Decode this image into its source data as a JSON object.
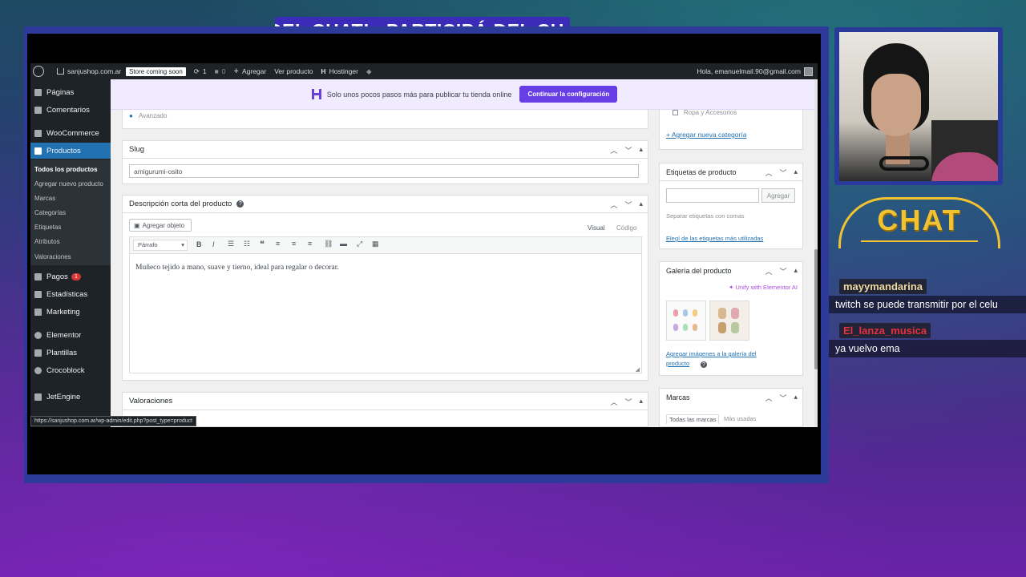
{
  "banner": {
    "text": "DEL CHAT!   PARTICIPÁ DEL CH"
  },
  "adminbar": {
    "site": "sanjushop.com.ar",
    "store_badge": "Store coming soon",
    "updates": "1",
    "comments": "0",
    "add": "Agregar",
    "view_product": "Ver producto",
    "hostinger": "Hostinger",
    "greeting": "Hola, emanuelmail.90@gmail.com"
  },
  "sidebar": {
    "items": [
      {
        "label": "Páginas"
      },
      {
        "label": "Comentarios"
      },
      {
        "label": "WooCommerce"
      },
      {
        "label": "Productos"
      },
      {
        "label": "Pagos",
        "badge": "1"
      },
      {
        "label": "Estadísticas"
      },
      {
        "label": "Marketing"
      },
      {
        "label": "Elementor"
      },
      {
        "label": "Plantillas"
      },
      {
        "label": "Crocoblock"
      },
      {
        "label": "JetEngine"
      }
    ],
    "submenu": [
      "Todos los productos",
      "Agregar nuevo producto",
      "Marcas",
      "Categorías",
      "Etiquetas",
      "Atributos",
      "Valoraciones"
    ]
  },
  "notice": {
    "text": "Solo unos pocos pasos más para publicar tu tienda online",
    "button": "Continuar la configuración"
  },
  "main": {
    "advanced_label": "Avanzado",
    "slug": {
      "title": "Slug",
      "value": "amigurumi-osito"
    },
    "short_desc": {
      "title": "Descripción corta del producto",
      "add_object": "Agregar objeto",
      "tab_visual": "Visual",
      "tab_code": "Código",
      "format": "Párrafo",
      "content": "Muñeco tejido a mano, suave y tierno, ideal para regalar o decorar."
    },
    "reviews": {
      "title": "Valoraciones"
    }
  },
  "side": {
    "category_item": "Ropa y Accesorios",
    "add_category": "+ Agregar nueva categoría",
    "tags": {
      "title": "Etiquetas de producto",
      "button": "Agregar",
      "hint": "Separar etiquetas con comas",
      "most_used": "Elegí de las etiquetas más utilizadas"
    },
    "gallery": {
      "title": "Galería del producto",
      "unify": "Unify with Elementor AI",
      "add_images": "Agregar imágenes a la galería del producto"
    },
    "brands": {
      "title": "Marcas",
      "tab_all": "Todas las marcas",
      "tab_most": "Más usadas"
    }
  },
  "status_url": "https://sanjushop.com.ar/wp-admin/edit.php?post_type=product",
  "chat_logo": "CHAT",
  "chat": [
    {
      "user": "mayymandarina",
      "message": "twitch se puede transmitir por el celu",
      "color": "#f0d8a0"
    },
    {
      "user": "El_lanza_musica",
      "message": "ya vuelvo ema",
      "color": "#e8303a"
    }
  ]
}
